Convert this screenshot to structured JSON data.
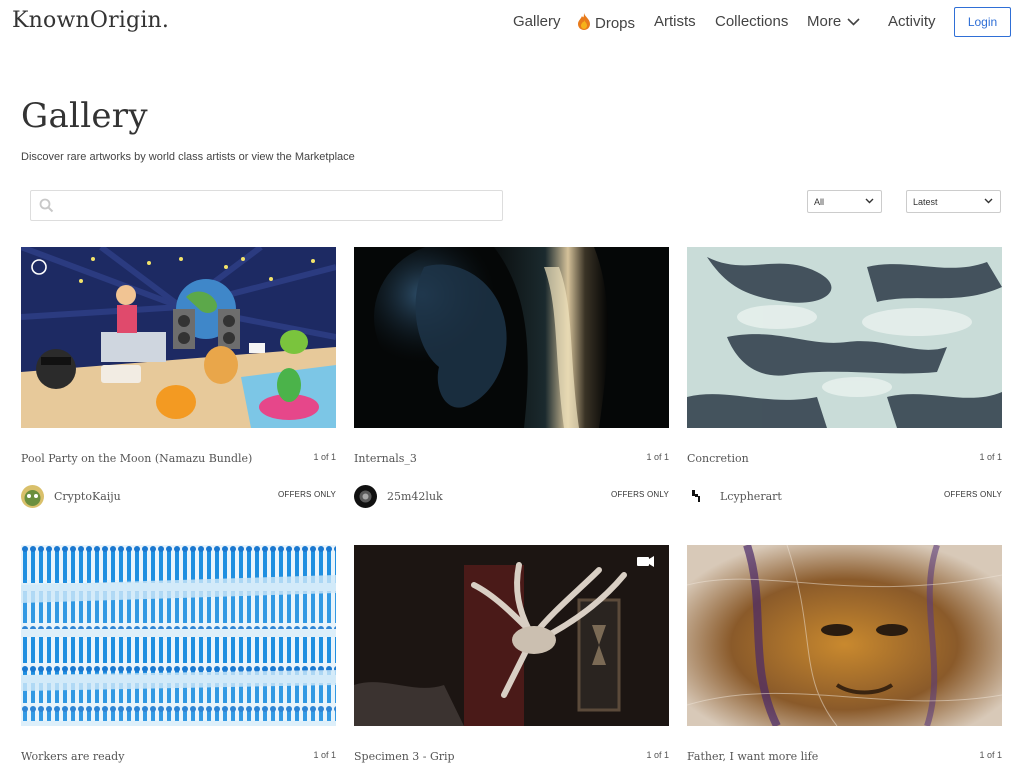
{
  "header": {
    "logo": "KnownOrigin.",
    "nav": {
      "gallery": "Gallery",
      "drops": "Drops",
      "artists": "Artists",
      "collections": "Collections",
      "more": "More",
      "activity": "Activity"
    },
    "login": "Login"
  },
  "page": {
    "title": "Gallery",
    "subtitle": "Discover rare artworks by world class artists or view the Marketplace"
  },
  "search": {
    "placeholder": "",
    "value": ""
  },
  "filters": {
    "category": "All",
    "sort": "Latest"
  },
  "colors": {
    "accent": "#2f6fd6",
    "text": "#333333"
  },
  "cards": [
    {
      "title": "Pool Party on the Moon (Namazu Bundle)",
      "edition": "1 of 1",
      "artist": "CryptoKaiju",
      "status": "OFFERS ONLY"
    },
    {
      "title": "Internals_3",
      "edition": "1 of 1",
      "artist": "25m42luk",
      "status": "OFFERS ONLY"
    },
    {
      "title": "Concretion",
      "edition": "1 of 1",
      "artist": "Lcypherart",
      "status": "OFFERS ONLY"
    },
    {
      "title": "Workers are ready",
      "edition": "1 of 1"
    },
    {
      "title": "Specimen 3 - Grip",
      "edition": "1 of 1"
    },
    {
      "title": "Father, I want more life",
      "edition": "1 of 1"
    }
  ]
}
